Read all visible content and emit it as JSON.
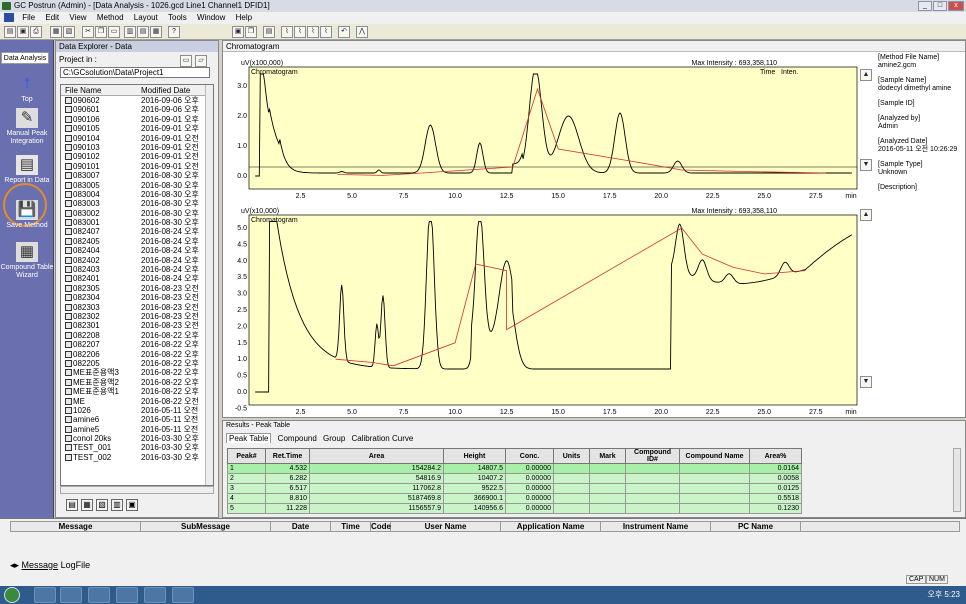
{
  "title_bar": {
    "title": "GC Postrun (Admin) - [Data Analysis - 1026.gcd Line1 Channel1 DFID1]"
  },
  "menu": [
    "File",
    "Edit",
    "View",
    "Method",
    "Layout",
    "Tools",
    "Window",
    "Help"
  ],
  "left_bar": {
    "tab": "Data Analysis",
    "items": [
      "Top",
      "Manual Peak Integration",
      "Report in Data",
      "Save Method",
      "Compound Table Wizard"
    ]
  },
  "explorer": {
    "title": "Data Explorer - Data",
    "project_label": "Project in :",
    "path": "C:\\GCsolution\\Data\\Project1",
    "columns": [
      "File Name",
      "Modified Date"
    ],
    "files": [
      [
        "090602",
        "2016-09-06 오후"
      ],
      [
        "090601",
        "2016-09-06 오후"
      ],
      [
        "090106",
        "2016-09-01 오후"
      ],
      [
        "090105",
        "2016-09-01 오후"
      ],
      [
        "090104",
        "2016-09-01 오전"
      ],
      [
        "090103",
        "2016-09-01 오전"
      ],
      [
        "090102",
        "2016-09-01 오전"
      ],
      [
        "090101",
        "2016-09-01 오전"
      ],
      [
        "083007",
        "2016-08-30 오후"
      ],
      [
        "083005",
        "2016-08-30 오후"
      ],
      [
        "083004",
        "2016-08-30 오후"
      ],
      [
        "083003",
        "2016-08-30 오후"
      ],
      [
        "083002",
        "2016-08-30 오후"
      ],
      [
        "083001",
        "2016-08-30 오후"
      ],
      [
        "082407",
        "2016-08-24 오후"
      ],
      [
        "082405",
        "2016-08-24 오후"
      ],
      [
        "082404",
        "2016-08-24 오후"
      ],
      [
        "082402",
        "2016-08-24 오후"
      ],
      [
        "082403",
        "2016-08-24 오후"
      ],
      [
        "082401",
        "2016-08-24 오후"
      ],
      [
        "082305",
        "2016-08-23 오전"
      ],
      [
        "082304",
        "2016-08-23 오전"
      ],
      [
        "082303",
        "2016-08-23 오전"
      ],
      [
        "082302",
        "2016-08-23 오전"
      ],
      [
        "082301",
        "2016-08-23 오전"
      ],
      [
        "082208",
        "2016-08-22 오후"
      ],
      [
        "082207",
        "2016-08-22 오후"
      ],
      [
        "082206",
        "2016-08-22 오후"
      ],
      [
        "082205",
        "2016-08-22 오후"
      ],
      [
        "ME표준용액3",
        "2016-08-22 오후"
      ],
      [
        "ME표준용액2",
        "2016-08-22 오후"
      ],
      [
        "ME표준용액1",
        "2016-08-22 오후"
      ],
      [
        "ME",
        "2016-08-22 오전"
      ],
      [
        "1026",
        "2016-05-11 오전"
      ],
      [
        "amine6",
        "2016-05-11 오전"
      ],
      [
        "amine5",
        "2016-05-11 오전"
      ],
      [
        "conol 20ks",
        "2016-03-30 오후"
      ],
      [
        "TEST_001",
        "2016-03-30 오후"
      ],
      [
        "TEST_002",
        "2016-03-30 오후"
      ]
    ]
  },
  "chromatogram": {
    "window_title": "Chromatogram",
    "top": {
      "ylabel": "uV(x100,000)",
      "label": "Chromatogram",
      "max_intensity": "Max Intensity : 693,358,110",
      "time_label": "Time",
      "inten_label": "Inten.",
      "yticks": [
        "3.0",
        "2.0",
        "1.0",
        "0.0"
      ]
    },
    "bottom": {
      "ylabel": "uV(x10,000)",
      "label": "Chromatogram",
      "max_intensity": "Max Intensity : 693,358,110",
      "yticks": [
        "5.0",
        "4.5",
        "4.0",
        "3.5",
        "3.0",
        "2.5",
        "2.0",
        "1.5",
        "1.0",
        "0.5",
        "0.0",
        "-0.5"
      ]
    },
    "xticks": [
      "2.5",
      "5.0",
      "7.5",
      "10.0",
      "12.5",
      "15.0",
      "17.5",
      "20.0",
      "22.5",
      "25.0",
      "27.5"
    ],
    "x_unit": "min"
  },
  "info_panel": [
    {
      "label": "[Method File Name]",
      "value": "amine2.gcm"
    },
    {
      "label": "[Sample Name]",
      "value": "dodecyl dimethyl amine"
    },
    {
      "label": "[Sample ID]",
      "value": ""
    },
    {
      "label": "[Analyzed by]",
      "value": "Admin"
    },
    {
      "label": "[Analyzed Date]",
      "value": "2016-05-11 오전 10:26:29"
    },
    {
      "label": "[Sample Type]",
      "value": "Unknown"
    },
    {
      "label": "[Description]",
      "value": ""
    }
  ],
  "results": {
    "title": "Results - Peak Table",
    "tabs": [
      "Peak Table",
      "Compound",
      "Group",
      "Calibration Curve"
    ],
    "columns": [
      "Peak#",
      "Ret.Time",
      "Area",
      "Height",
      "Conc.",
      "Units",
      "Mark",
      "Compound ID#",
      "Compound Name",
      "Area%"
    ],
    "rows": [
      [
        "1",
        "4.532",
        "154284.2",
        "14807.5",
        "0.00000",
        "",
        "",
        "",
        "",
        "0.0164"
      ],
      [
        "2",
        "6.282",
        "54816.9",
        "10407.2",
        "0.00000",
        "",
        "",
        "",
        "",
        "0.0058"
      ],
      [
        "3",
        "6.517",
        "117062.8",
        "9522.5",
        "0.00000",
        "",
        "",
        "",
        "",
        "0.0125"
      ],
      [
        "4",
        "8.810",
        "5187469.8",
        "366900.1",
        "0.00000",
        "",
        "",
        "",
        "",
        "0.5518"
      ],
      [
        "5",
        "11.228",
        "1156557.9",
        "140956.6",
        "0.00000",
        "",
        "",
        "",
        "",
        "0.1230"
      ]
    ]
  },
  "messages": {
    "columns": [
      "Message",
      "SubMessage",
      "Date",
      "Time",
      "Code",
      "User Name",
      "Application Name",
      "Instrument Name",
      "PC Name"
    ],
    "tabs": [
      "Message",
      "LogFile"
    ]
  },
  "status": {
    "cap": "CAP",
    "num": "NUM"
  },
  "taskbar": {
    "clock": "오후 5:23"
  }
}
